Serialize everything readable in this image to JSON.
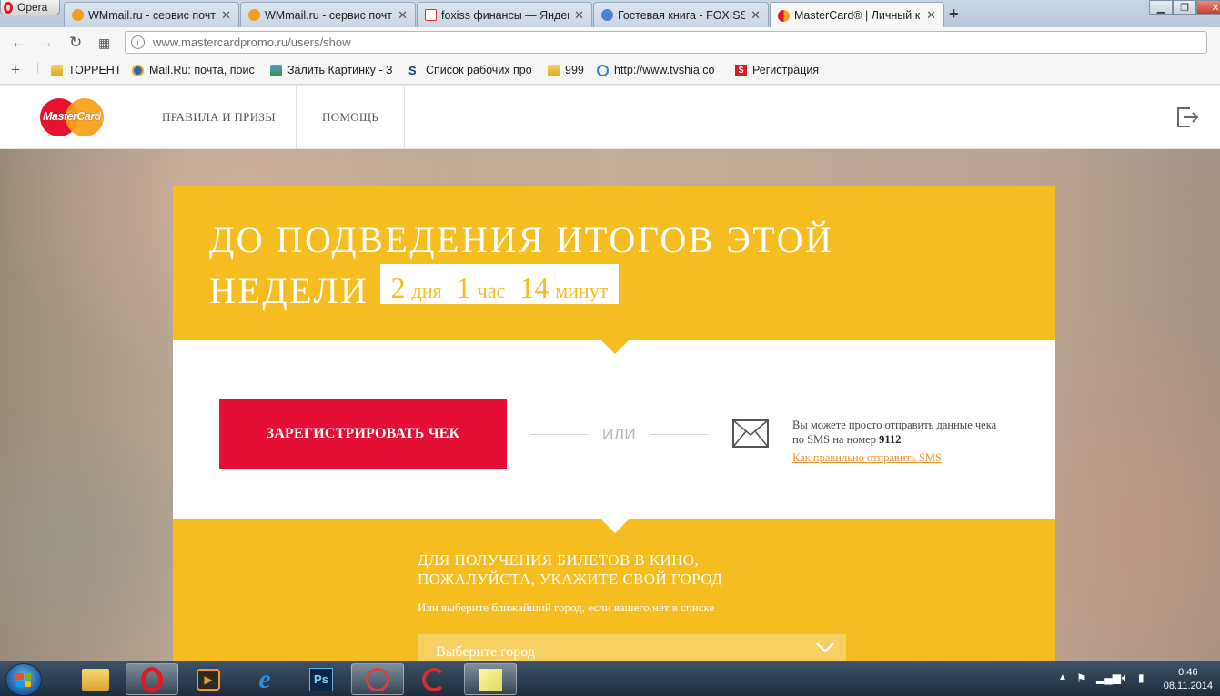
{
  "browser": {
    "menu_label": "Opera",
    "tabs": [
      {
        "title": "WMmail.ru - сервис почтового",
        "fav_color": "#f59a1d"
      },
      {
        "title": "WMmail.ru - сервис почтового",
        "fav_color": "#f59a1d"
      },
      {
        "title": "foxiss финансы — Яндекс",
        "fav_color": "#e0312d"
      },
      {
        "title": "Гостевая книга - FOXISS",
        "fav_color": "#4a7fd4"
      },
      {
        "title": "MasterCard® | Личный кабинет",
        "fav_color": "#e8112d"
      }
    ],
    "new_tab": "+",
    "close_glyph": "✕",
    "url_host": "www.mastercardpromo.ru",
    "url_path": "/users/show",
    "bookmarks": [
      {
        "label": "ТОРРЕНТ"
      },
      {
        "label": "Mail.Ru: почта, поис"
      },
      {
        "label": "Залить Картинку - З"
      },
      {
        "label": "Список рабочих про"
      },
      {
        "label": "999"
      },
      {
        "label": "http://www.tvshia.co"
      },
      {
        "label": "Регистрация"
      }
    ],
    "bookmark_add": "+"
  },
  "site": {
    "logo_text": "MasterCard",
    "nav": [
      {
        "label": "ПРАВИЛА И ПРИЗЫ"
      },
      {
        "label": "ПОМОЩЬ"
      }
    ],
    "countdown": {
      "line1": "ДО ПОДВЕДЕНИЯ ИТОГОВ ЭТОЙ",
      "line2": "НЕДЕЛИ",
      "days": "2",
      "days_unit": "дня",
      "hours": "1",
      "hours_unit": "час",
      "minutes": "14",
      "minutes_unit": "минут"
    },
    "register_button": "ЗАРЕГИСТРИРОВАТЬ ЧЕК",
    "or_text": "ИЛИ",
    "sms": {
      "text": "Вы можете просто отправить данные чека по SMS на номер",
      "number": "9112",
      "link": "Как правильно отправить SMS"
    },
    "city": {
      "heading_line1": "ДЛЯ ПОЛУЧЕНИЯ БИЛЕТОВ В КИНО,",
      "heading_line2": "ПОЖАЛУЙСТА, УКАЖИТЕ СВОЙ ГОРОД",
      "subtext": "Или выберите ближайший город, если вашего нет в списке",
      "select_placeholder": "Выберите город"
    },
    "colors": {
      "accent_yellow": "#f6bd21",
      "register_red": "#e50e34",
      "link_orange": "#f0932e"
    }
  },
  "taskbar": {
    "time": "0:46",
    "date": "08.11.2014"
  }
}
